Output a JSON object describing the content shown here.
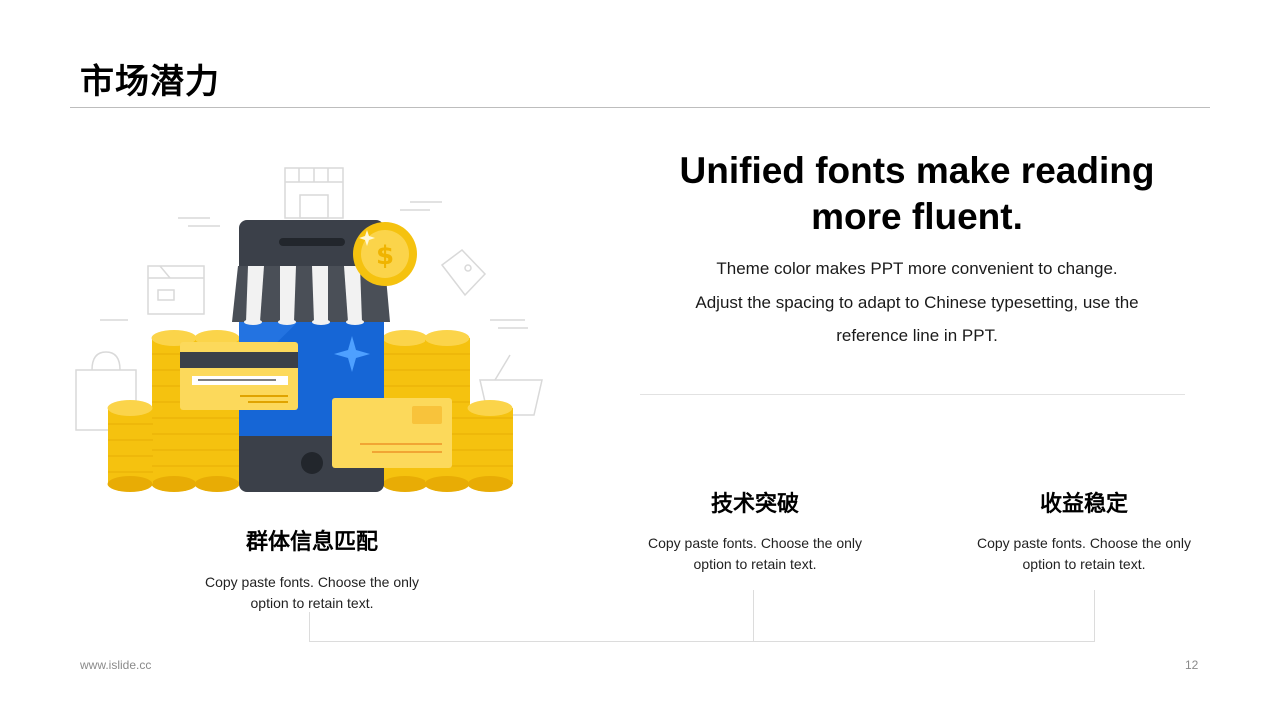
{
  "slide": {
    "title": "市场潜力"
  },
  "headline": {
    "title_line1": "Unified fonts make reading",
    "title_line2": "more fluent.",
    "body_line1": "Theme color makes PPT more convenient to change.",
    "body_line2": "Adjust the spacing to adapt to Chinese typesetting, use the",
    "body_line3": "reference line in PPT."
  },
  "features": [
    {
      "heading": "群体信息匹配",
      "text_line1": "Copy paste fonts. Choose the only",
      "text_line2": "option to retain text."
    },
    {
      "heading": "技术突破",
      "text_line1": "Copy paste fonts. Choose the only",
      "text_line2": "option to retain text."
    },
    {
      "heading": "收益稳定",
      "text_line1": "Copy paste fonts. Choose the only",
      "text_line2": "option to retain text."
    }
  ],
  "footer": {
    "url": "www.islide.cc",
    "page_number": "12"
  },
  "illustration": {
    "subject": "mobile-shop-with-coins-and-cards",
    "colors": {
      "phone": "#3b4049",
      "screen": "#1666d6",
      "coin": "#f5c20f",
      "card": "#fcd95b",
      "awning": "#4a4f57",
      "line_art": "#d9d9d9"
    }
  }
}
